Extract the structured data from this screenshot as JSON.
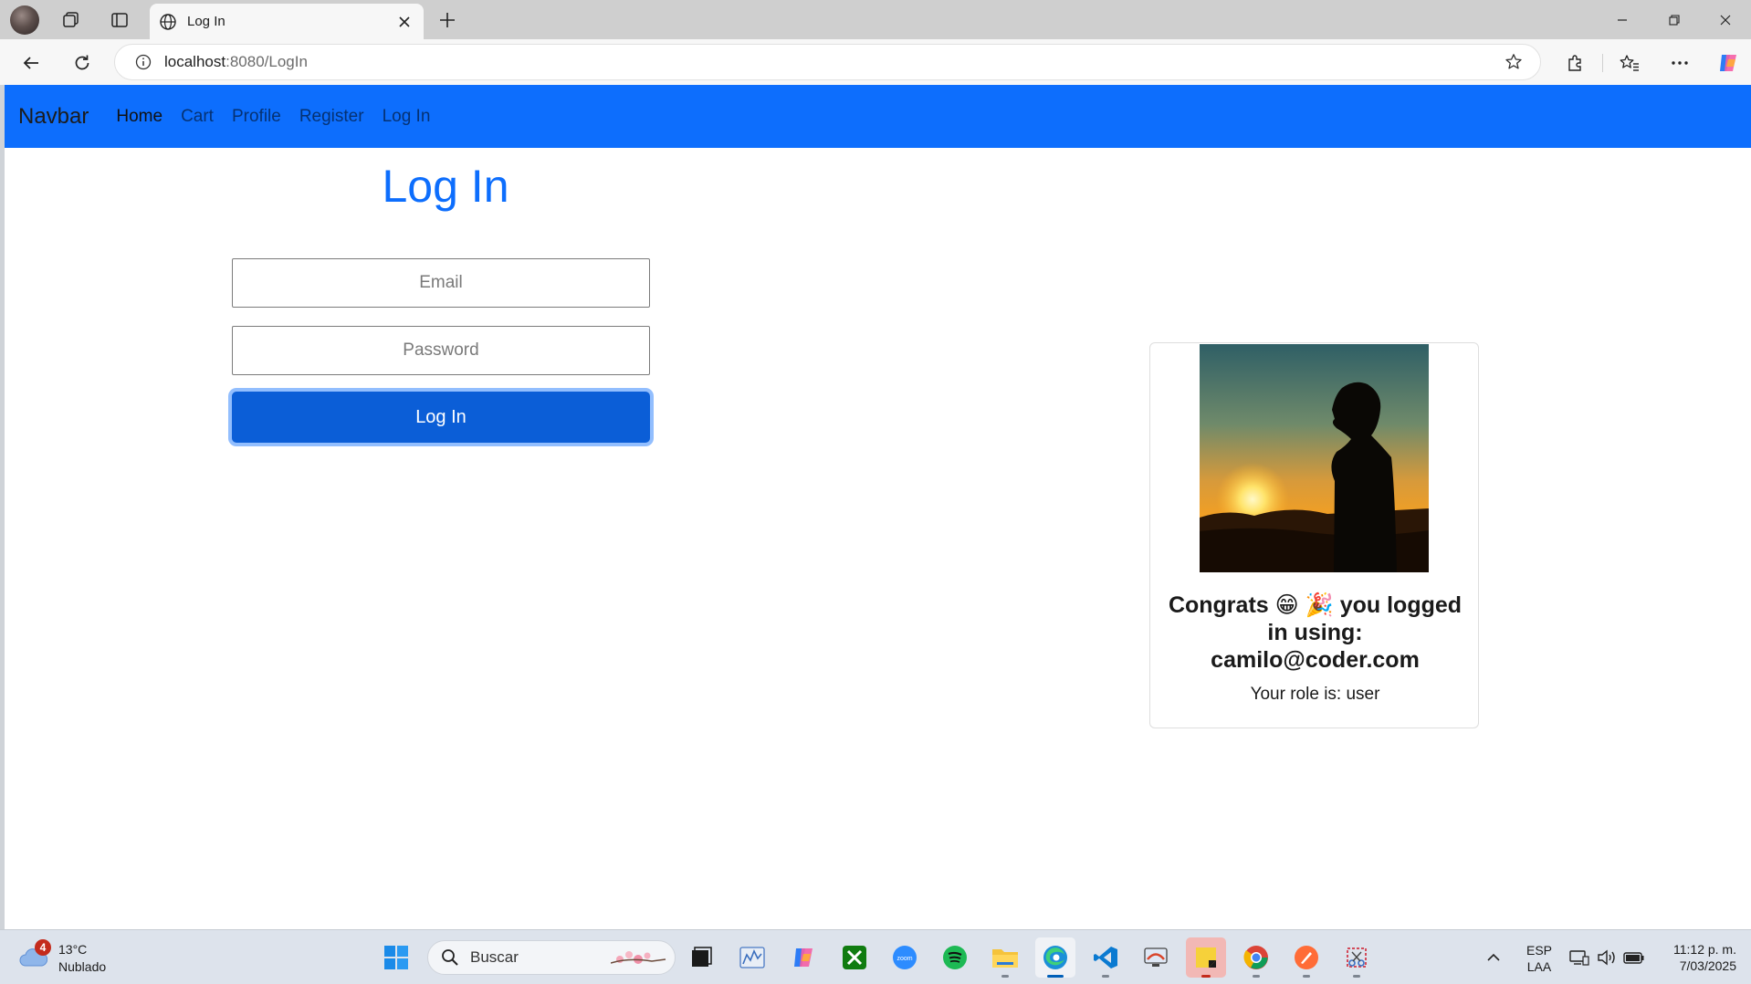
{
  "browser": {
    "tab_title": "Log In",
    "url_host": "localhost",
    "url_path": ":8080/LogIn"
  },
  "navbar": {
    "brand": "Navbar",
    "links": [
      {
        "label": "Home",
        "active": true
      },
      {
        "label": "Cart",
        "active": false
      },
      {
        "label": "Profile",
        "active": false
      },
      {
        "label": "Register",
        "active": false
      },
      {
        "label": "Log In",
        "active": false
      }
    ]
  },
  "login": {
    "title": "Log In",
    "email_placeholder": "Email",
    "password_placeholder": "Password",
    "button_label": "Log In"
  },
  "card": {
    "congrats_prefix": "Congrats",
    "congrats_emoji": "😁 🎉",
    "congrats_suffix": "you logged in using:",
    "email": "camilo@coder.com",
    "role_text": "Your role is: user"
  },
  "taskbar": {
    "weather_badge": "4",
    "temperature": "13°C",
    "condition": "Nublado",
    "search_label": "Buscar",
    "lang_top": "ESP",
    "lang_bottom": "LAA",
    "time": "11:12 p. m.",
    "date": "7/03/2025"
  },
  "colors": {
    "primary": "#0d6efd",
    "button": "#0b5ed7",
    "taskbar": "#dde3ec"
  }
}
